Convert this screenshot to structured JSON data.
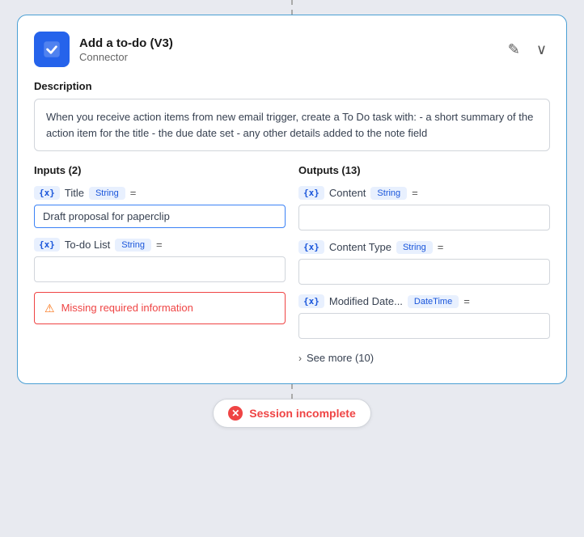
{
  "card": {
    "title": "Add a to-do (V3)",
    "subtitle": "Connector",
    "description": "When you receive action items from new email trigger, create a To Do task with: - a short summary of the action item for the title - the due date set - any other details added to the note field"
  },
  "inputs": {
    "label": "Inputs (2)",
    "fields": [
      {
        "badge": "{x}",
        "name": "Title",
        "type": "String",
        "value": "Draft proposal for paperclip"
      },
      {
        "badge": "{x}",
        "name": "To-do List",
        "type": "String",
        "value": ""
      }
    ],
    "error": "Missing required information"
  },
  "outputs": {
    "label": "Outputs (13)",
    "fields": [
      {
        "badge": "{x}",
        "name": "Content",
        "type": "String",
        "value": ""
      },
      {
        "badge": "{x}",
        "name": "Content Type",
        "type": "String",
        "value": ""
      },
      {
        "badge": "{x}",
        "name": "Modified Date...",
        "type": "DateTime",
        "value": ""
      }
    ],
    "see_more": "See more (10)"
  },
  "session": {
    "label": "Session incomplete"
  },
  "icons": {
    "edit": "✎",
    "chevron_down": "∨",
    "chevron_right": "›",
    "error_triangle": "⚠",
    "error_x": "✕"
  }
}
